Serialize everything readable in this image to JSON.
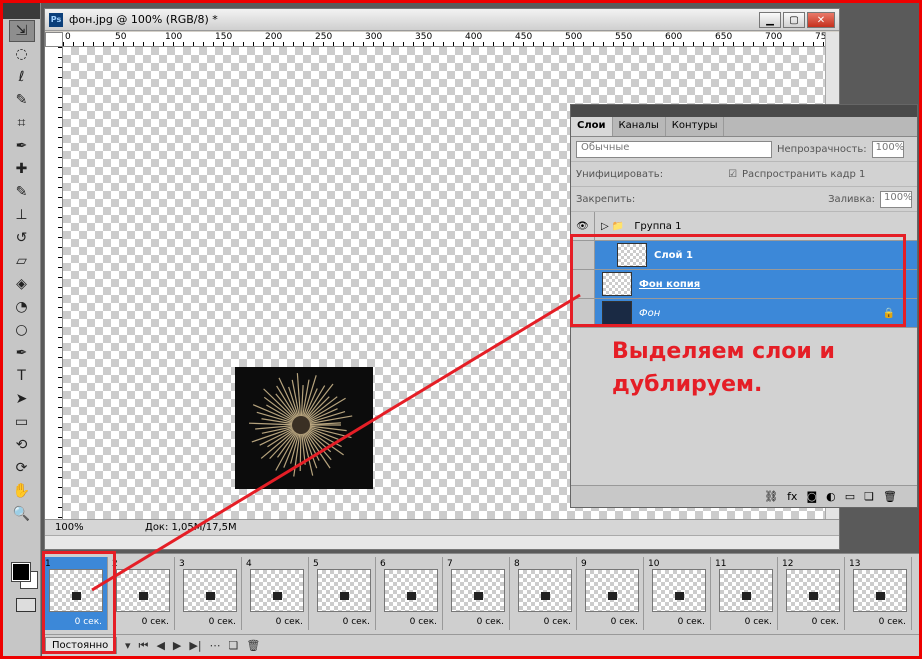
{
  "accent_color": "#e51e26",
  "selection_color": "#3c88d8",
  "tools": [
    "move-icon",
    "marquee-icon",
    "lasso-icon",
    "quick-select-icon",
    "crop-icon",
    "eyedropper-icon",
    "healing-icon",
    "brush-icon",
    "stamp-icon",
    "history-brush-icon",
    "eraser-icon",
    "bucket-icon",
    "blur-icon",
    "dodge-icon",
    "pen-icon",
    "type-icon",
    "path-select-icon",
    "shape-icon",
    "3d-rotate-icon",
    "3d-orbit-icon",
    "hand-icon",
    "zoom-icon"
  ],
  "document": {
    "title": "фон.jpg @ 100% (RGB/8) *",
    "ruler_marks": [
      "0",
      "50",
      "100",
      "150",
      "200",
      "250",
      "300",
      "350",
      "400",
      "450",
      "500",
      "550",
      "600",
      "650",
      "700",
      "750"
    ],
    "zoom": "100%",
    "doc_info": "Док: 1,05M/17,5M"
  },
  "layers_panel": {
    "tabs": [
      "Слои",
      "Каналы",
      "Контуры"
    ],
    "blend_mode": "Обычные",
    "opacity_label": "Непрозрачность:",
    "opacity_value": "100%",
    "unify_label": "Унифицировать:",
    "propagate_label": "Распространить кадр 1",
    "lock_label": "Закрепить:",
    "fill_label": "Заливка:",
    "fill_value": "100%",
    "layers": [
      {
        "name": "Группа 1"
      },
      {
        "name": "Слой 1"
      },
      {
        "name": "Фон копия"
      },
      {
        "name": "Фон"
      }
    ]
  },
  "annotation": "Выделяем слои и дублируем.",
  "timeline": {
    "frames": [
      {
        "num": "1",
        "delay": "0 сек."
      },
      {
        "num": "2",
        "delay": "0 сек."
      },
      {
        "num": "3",
        "delay": "0 сек."
      },
      {
        "num": "4",
        "delay": "0 сек."
      },
      {
        "num": "5",
        "delay": "0 сек."
      },
      {
        "num": "6",
        "delay": "0 сек."
      },
      {
        "num": "7",
        "delay": "0 сек."
      },
      {
        "num": "8",
        "delay": "0 сек."
      },
      {
        "num": "9",
        "delay": "0 сек."
      },
      {
        "num": "10",
        "delay": "0 сек."
      },
      {
        "num": "11",
        "delay": "0 сек."
      },
      {
        "num": "12",
        "delay": "0 сек."
      },
      {
        "num": "13",
        "delay": "0 сек."
      }
    ],
    "loop": "Постоянно"
  }
}
